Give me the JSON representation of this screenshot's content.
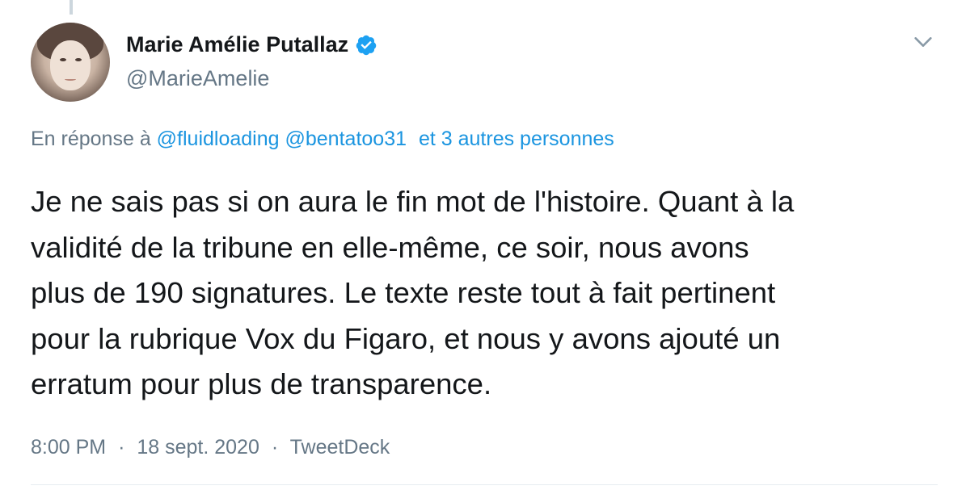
{
  "author": {
    "display_name": "Marie Amélie Putallaz",
    "handle": "@MarieAmelie",
    "verified": true,
    "avatar_icon": "profile-photo"
  },
  "reply": {
    "prefix": "En réponse à",
    "mentions": [
      "@fluidloading",
      "@bentatoo31"
    ],
    "others": "et 3 autres personnes"
  },
  "body": {
    "lines": [
      "Je ne sais pas si on aura le fin mot de l'histoire. Quant à la",
      "validité de la tribune en elle-même, ce soir, nous avons",
      "plus de 190 signatures. Le texte reste tout à fait pertinent",
      "pour la rubrique Vox du Figaro, et nous y avons ajouté un",
      "erratum pour plus de transparence."
    ]
  },
  "meta": {
    "time": "8:00 PM",
    "date": "18 sept. 2020",
    "source": "TweetDeck",
    "separator": "·"
  },
  "icons": {
    "verified": "verified-badge-icon",
    "more": "chevron-down-icon"
  },
  "colors": {
    "link": "#1b95e0",
    "secondary_text": "#657786",
    "primary_text": "#14171a",
    "verified_blue": "#1da1f2"
  }
}
